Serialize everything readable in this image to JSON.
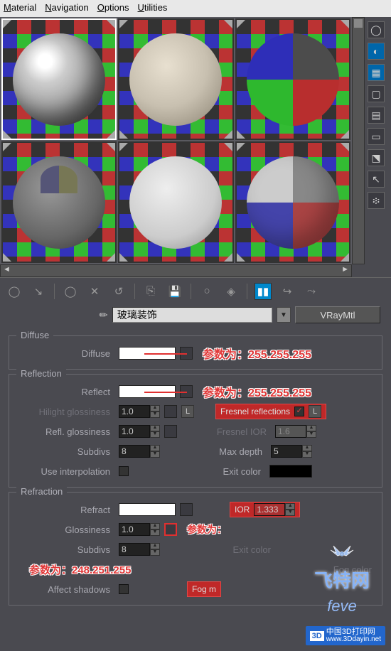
{
  "menu": {
    "material": "Material",
    "navigation": "Navigation",
    "options": "Options",
    "utilities": "Utilities"
  },
  "material": {
    "name": "玻璃装饰",
    "type": "VRayMtl"
  },
  "diffuse": {
    "group": "Diffuse",
    "label": "Diffuse",
    "swatch": "#ffffff",
    "callout": "参数为：255.255.255"
  },
  "reflection": {
    "group": "Reflection",
    "reflect_label": "Reflect",
    "reflect_swatch": "#ffffff",
    "reflect_callout": "参数为：255.255.255",
    "hilight_label": "Hilight glossiness",
    "hilight_val": "1.0",
    "lbtn": "L",
    "fresnel_label": "Fresnel reflections",
    "refl_gloss_label": "Refl. glossiness",
    "refl_gloss_val": "1.0",
    "fresnel_ior_label": "Fresnel IOR",
    "fresnel_ior_val": "1.6",
    "subdivs_label": "Subdivs",
    "subdivs_val": "8",
    "maxdepth_label": "Max depth",
    "maxdepth_val": "5",
    "useinterp_label": "Use interpolation",
    "exitcolor_label": "Exit color",
    "exitcolor_swatch": "#000000"
  },
  "refraction": {
    "group": "Refraction",
    "refract_label": "Refract",
    "refract_swatch": "#ffffff",
    "ior_label": "IOR",
    "ior_val": "1.333",
    "gloss_label": "Glossiness",
    "gloss_val": "1.0",
    "gloss_callout": "参数为：",
    "subdivs_label": "Subdivs",
    "subdivs_val": "8",
    "exitcolor_label": "Exit color",
    "fog_label": "Fog color",
    "affect_label": "Affect shadows",
    "fogm_label": "Fog m",
    "refract_callout": "参数为：248.251.255"
  },
  "watermark": {
    "brand": "飞特网",
    "sub": "feve",
    "badge": "中国3D打印网",
    "url": "www.3Ddayin.net",
    "cube": "3D"
  }
}
